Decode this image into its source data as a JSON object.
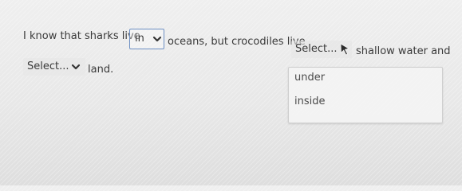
{
  "sentence": {
    "part1": "I know that sharks live",
    "part2": "oceans, but crocodiles live",
    "part3": "shallow water and",
    "part4": "land."
  },
  "dropdowns": {
    "first": {
      "value": "in"
    },
    "second": {
      "value": "Select..."
    },
    "third": {
      "value": "Select..."
    }
  },
  "menu": {
    "options": [
      "under",
      "inside"
    ]
  },
  "icons": {
    "chevron": "chevron-down-icon",
    "cursor": "mouse-cursor-icon"
  },
  "colors": {
    "selected_border": "#6d8fc3"
  }
}
